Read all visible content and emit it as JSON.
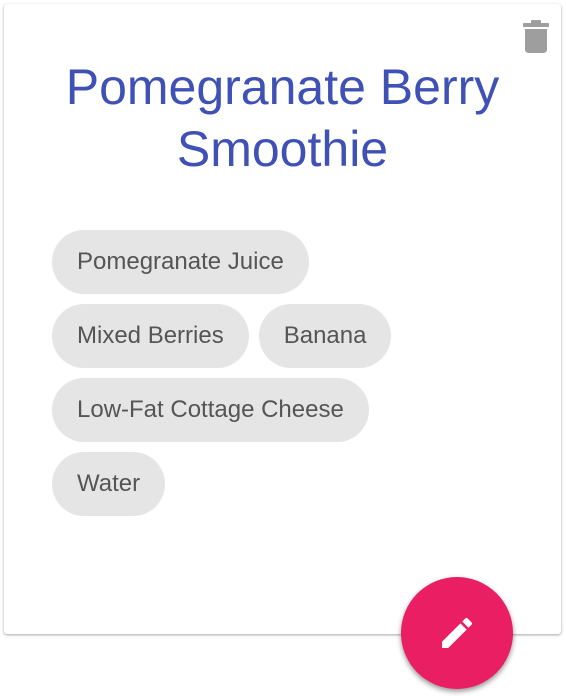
{
  "recipe": {
    "title": "Pomegranate Berry Smoothie",
    "ingredients": [
      "Pomegranate Juice",
      "Mixed Berries",
      "Banana",
      "Low-Fat Cottage Cheese",
      "Water"
    ]
  },
  "actions": {
    "delete_icon": "trash-icon",
    "edit_icon": "pencil-icon"
  },
  "colors": {
    "title": "#3f51b5",
    "fab": "#e91e63",
    "chip_bg": "#e5e5e5",
    "chip_text": "#555555",
    "delete_icon": "#9e9e9e"
  }
}
